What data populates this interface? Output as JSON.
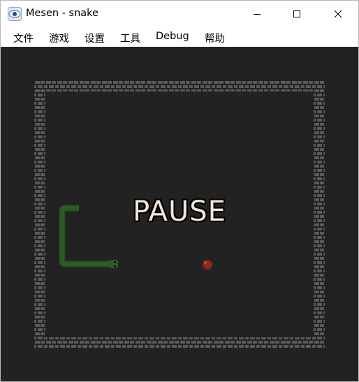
{
  "window": {
    "title": "Mesen - snake",
    "app_icon": "mesen-eye-icon",
    "controls": {
      "minimize_icon": "minimize-icon",
      "maximize_icon": "maximize-icon",
      "close_icon": "close-icon"
    }
  },
  "menu": {
    "items": [
      {
        "label": "文件"
      },
      {
        "label": "游戏"
      },
      {
        "label": "设置"
      },
      {
        "label": "工具"
      },
      {
        "label": "Debug"
      },
      {
        "label": "帮助"
      }
    ]
  },
  "game": {
    "status_text": "PAUSE",
    "colors": {
      "background": "#222222",
      "wall": "#5a5a5a",
      "snake": "#2d5a27",
      "apple": "#8a2a22",
      "pause_text": "#f3e6d6"
    }
  }
}
